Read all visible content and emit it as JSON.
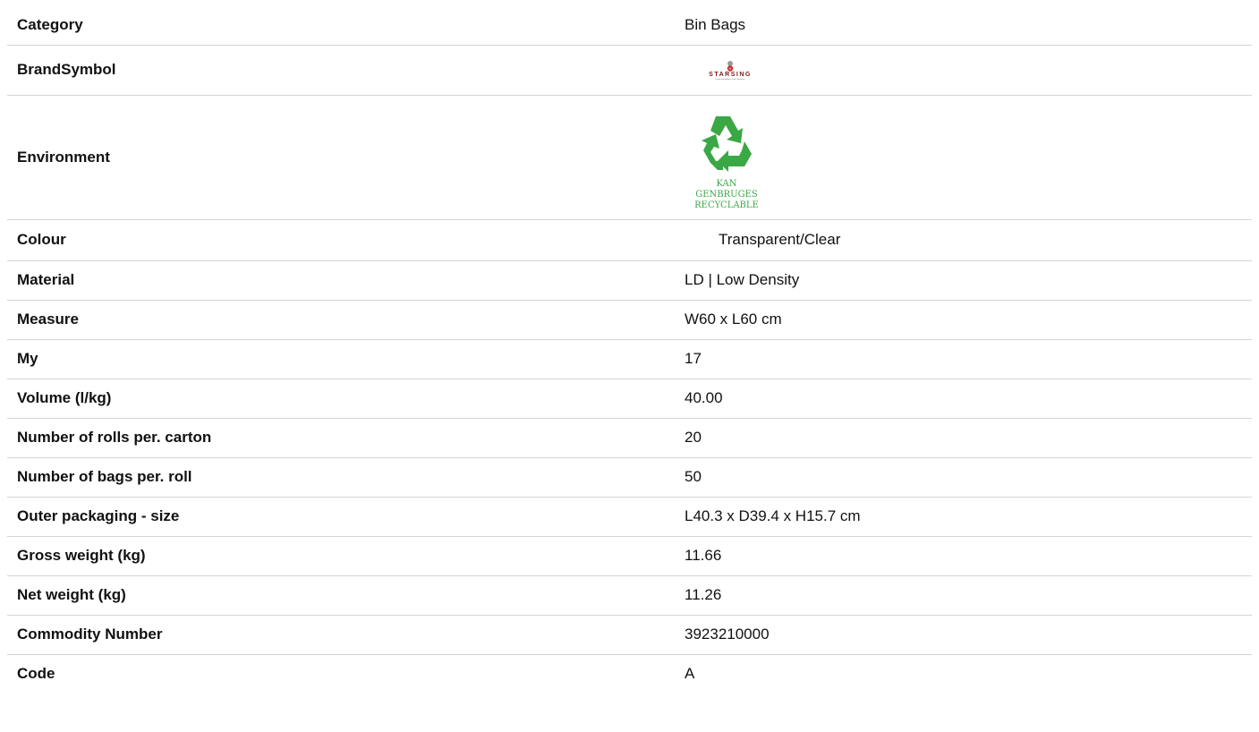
{
  "specs": [
    {
      "label": "Category",
      "value": "Bin Bags"
    },
    {
      "label": "BrandSymbol",
      "logo_text": "STARSING",
      "logo_tagline": "Lorem Emballage, Kerfe Solutions",
      "logo_color": "#7a1a1a"
    },
    {
      "label": "Environment",
      "logo_lines": [
        "KAN",
        "GENBRUGES",
        "RECYCLABLE"
      ],
      "logo_color": "#3aa845",
      "icon": "recycle-icon"
    },
    {
      "label": "Colour",
      "value": "Transparent/Clear"
    },
    {
      "label": "Material",
      "value": "LD | Low Density"
    },
    {
      "label": "Measure",
      "value": "W60 x L60 cm"
    },
    {
      "label": "My",
      "value": "17"
    },
    {
      "label": "Volume (l/kg)",
      "value": "40.00"
    },
    {
      "label": "Number of rolls per. carton",
      "value": "20"
    },
    {
      "label": "Number of bags per. roll",
      "value": "50"
    },
    {
      "label": "Outer packaging - size",
      "value": "L40.3 x D39.4 x H15.7 cm"
    },
    {
      "label": "Gross weight (kg)",
      "value": "11.66"
    },
    {
      "label": "Net weight (kg)",
      "value": "11.26"
    },
    {
      "label": "Commodity Number",
      "value": "3923210000"
    },
    {
      "label": "Code",
      "value": "A"
    }
  ]
}
